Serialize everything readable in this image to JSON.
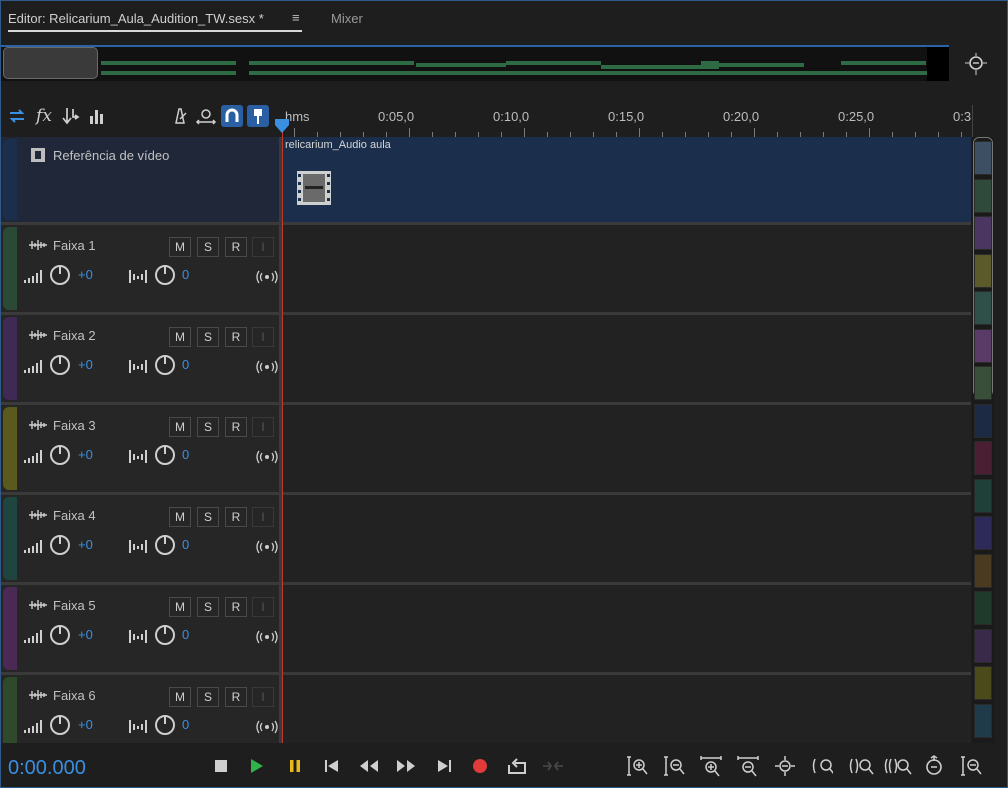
{
  "tabs": {
    "editor_label": "Editor: Relicarium_Aula_Audition_TW.sesx *",
    "menu_glyph": "≡",
    "mixer_label": "Mixer"
  },
  "ruler": {
    "labels": [
      "hms",
      "0:05,0",
      "0:10,0",
      "0:15,0",
      "0:20,0",
      "0:25,0",
      "0:3"
    ]
  },
  "video_track": {
    "name": "Referência de vídeo",
    "clip_name": "relicarium_Audio  aula"
  },
  "tracks": [
    {
      "name": "Faixa 1",
      "volume": "+0",
      "pan": "0",
      "mute": "M",
      "solo": "S",
      "arm": "R",
      "input": "I",
      "color": "#2a4a35"
    },
    {
      "name": "Faixa 2",
      "volume": "+0",
      "pan": "0",
      "mute": "M",
      "solo": "S",
      "arm": "R",
      "input": "I",
      "color": "#3f2a55"
    },
    {
      "name": "Faixa 3",
      "volume": "+0",
      "pan": "0",
      "mute": "M",
      "solo": "S",
      "arm": "R",
      "input": "I",
      "color": "#5a5a1e"
    },
    {
      "name": "Faixa 4",
      "volume": "+0",
      "pan": "0",
      "mute": "M",
      "solo": "S",
      "arm": "R",
      "input": "I",
      "color": "#1f4540"
    },
    {
      "name": "Faixa 5",
      "volume": "+0",
      "pan": "0",
      "mute": "M",
      "solo": "S",
      "arm": "R",
      "input": "I",
      "color": "#4a2a55"
    },
    {
      "name": "Faixa 6",
      "volume": "+0",
      "pan": "0",
      "mute": "M",
      "solo": "S",
      "arm": "R",
      "input": "I",
      "color": "#2f4a2a"
    }
  ],
  "transport": {
    "time": "0:00.000"
  },
  "colors": {
    "accent": "#3b8fe0",
    "playhead": "#c0392b",
    "clip": "#1b2e4b",
    "overview_wave": "#2e6b45"
  }
}
